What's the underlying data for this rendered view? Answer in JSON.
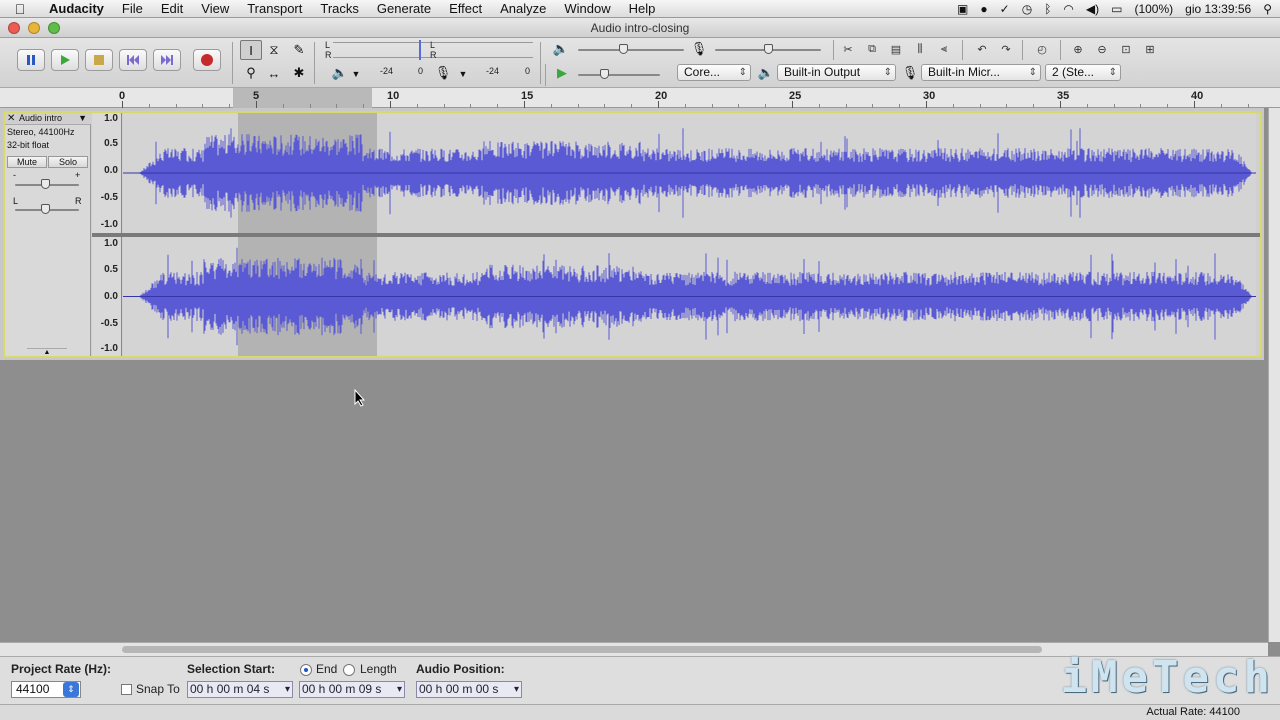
{
  "menubar": {
    "app": "Audacity",
    "items": [
      "File",
      "Edit",
      "View",
      "Transport",
      "Tracks",
      "Generate",
      "Effect",
      "Analyze",
      "Window",
      "Help"
    ],
    "battery": "(100%)",
    "clock": "gio 13:39:56"
  },
  "window": {
    "title": "Audio intro-closing"
  },
  "transport": {
    "buttons": [
      "pause",
      "play",
      "stop",
      "skip-start",
      "skip-end",
      "record"
    ]
  },
  "meters": {
    "play_labels": [
      "L",
      "R"
    ],
    "rec_labels": [
      "L",
      "R"
    ],
    "scale_a": [
      "-24",
      "0"
    ],
    "scale_b": [
      "-24",
      "0"
    ]
  },
  "device": {
    "host": "Core...",
    "output": "Built-in Output",
    "input": "Built-in Micr...",
    "channels": "2 (Ste..."
  },
  "ruler": {
    "labels": [
      "0",
      "5",
      "10",
      "15",
      "20",
      "25",
      "30",
      "35",
      "40"
    ]
  },
  "track": {
    "name": "Audio intro",
    "info_line1": "Stereo, 44100Hz",
    "info_line2": "32-bit float",
    "mute": "Mute",
    "solo": "Solo",
    "gain_minus": "-",
    "gain_plus": "+",
    "pan_l": "L",
    "pan_r": "R",
    "scale": [
      "1.0",
      "0.5",
      "0.0",
      "-0.5",
      "-1.0"
    ],
    "wave_color": "#5a5ad4"
  },
  "selectionbar": {
    "project_rate_label": "Project Rate (Hz):",
    "project_rate": "44100",
    "snap_to": "Snap To",
    "selection_start_label": "Selection Start:",
    "selection_start": "00 h 00 m 04 s",
    "end_label": "End",
    "length_label": "Length",
    "end_value": "00 h 00 m 09 s",
    "audio_position_label": "Audio Position:",
    "audio_position": "00 h 00 m 00 s"
  },
  "status": {
    "actual_rate": "Actual Rate: 44100"
  },
  "logo": {
    "text": "iMeTech"
  }
}
